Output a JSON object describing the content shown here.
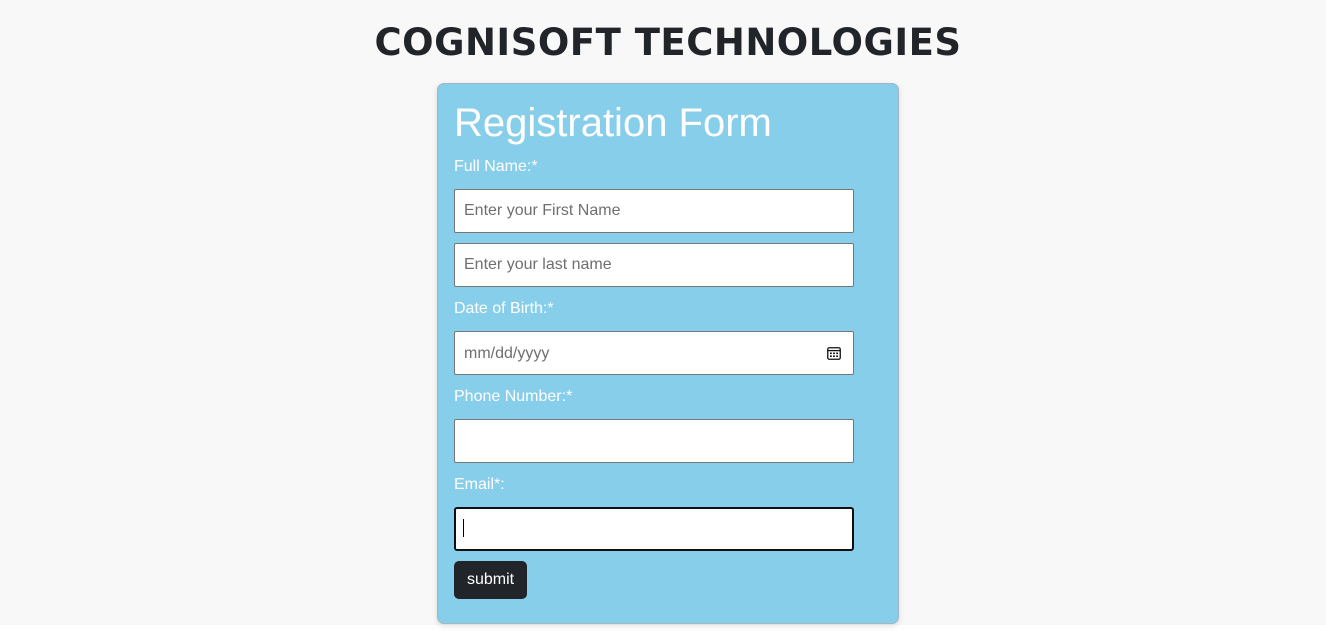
{
  "site": {
    "title": "COGNISOFT TECHNOLOGIES"
  },
  "form": {
    "heading": "Registration Form",
    "full_name": {
      "label": "Full Name:*",
      "first_placeholder": "Enter your First Name",
      "last_placeholder": "Enter your last name",
      "first_value": "",
      "last_value": ""
    },
    "dob": {
      "label": "Date of Birth:*",
      "placeholder": "mm/dd/yyyy",
      "icon": "calendar-icon"
    },
    "phone": {
      "label": "Phone Number:*",
      "value": ""
    },
    "email": {
      "label": "Email*:",
      "value": "",
      "focused": true
    },
    "submit_label": "submit"
  },
  "colors": {
    "page_background": "#f8f8f8",
    "card_background": "#87ceeb",
    "title_text": "#212529",
    "button_background": "#212529",
    "label_text": "#ffffff"
  }
}
